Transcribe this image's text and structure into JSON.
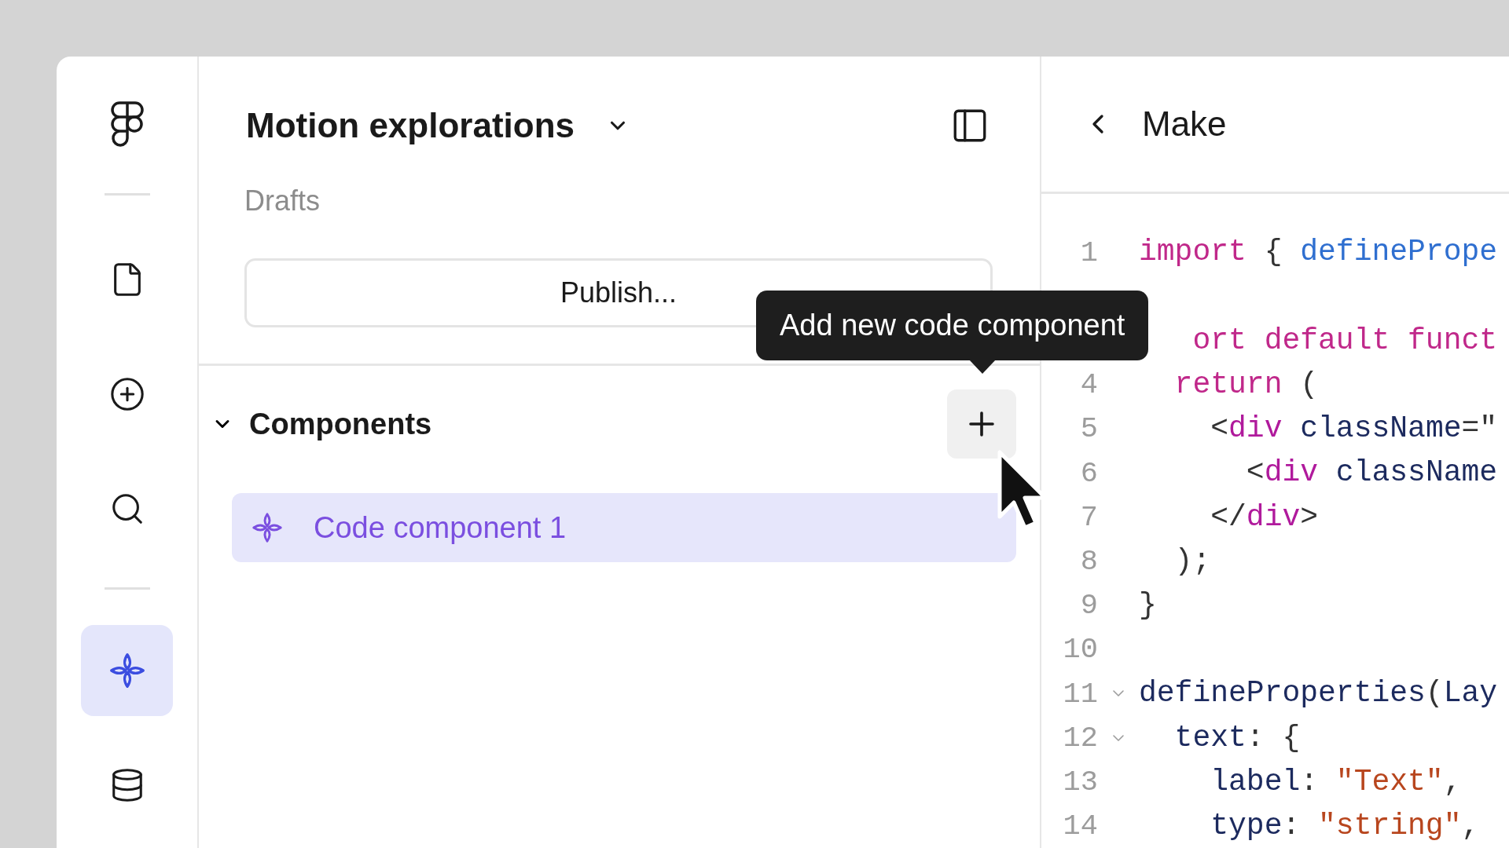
{
  "rail": {
    "groups": [
      [
        {
          "kind": "file",
          "selected": false
        },
        {
          "kind": "add",
          "selected": false
        },
        {
          "kind": "search",
          "selected": false
        }
      ],
      [
        {
          "kind": "components",
          "selected": true
        },
        {
          "kind": "data",
          "selected": false
        }
      ]
    ]
  },
  "panel": {
    "title": "Motion explorations",
    "subtitle": "Drafts",
    "publish_button": "Publish...",
    "section": {
      "title": "Components",
      "expanded": true,
      "items": [
        {
          "label": "Code component 1",
          "selected": true
        }
      ]
    },
    "tooltip": "Add new code component"
  },
  "editor": {
    "title": "Make",
    "lines": [
      {
        "number": "1",
        "tokens": [
          {
            "text": "import",
            "kind": "keyword"
          },
          {
            "text": " { ",
            "kind": "punct"
          },
          {
            "text": "definePrope",
            "kind": "ident"
          }
        ]
      },
      {
        "tokens": [
          {
            "text": "   ort default funct",
            "kind": "keyword"
          }
        ]
      },
      {
        "number": "4",
        "tokens": [
          {
            "text": "  return",
            "kind": "keyword"
          },
          {
            "text": " (",
            "kind": "punct"
          }
        ]
      },
      {
        "number": "5",
        "tokens": [
          {
            "text": "    <",
            "kind": "punct"
          },
          {
            "text": "div",
            "kind": "tag"
          },
          {
            "text": " className",
            "kind": "attr"
          },
          {
            "text": "=\"",
            "kind": "punct"
          }
        ]
      },
      {
        "number": "6",
        "tokens": [
          {
            "text": "      <",
            "kind": "punct"
          },
          {
            "text": "div",
            "kind": "tag"
          },
          {
            "text": " className",
            "kind": "attr"
          }
        ]
      },
      {
        "number": "7",
        "tokens": [
          {
            "text": "    </",
            "kind": "punct"
          },
          {
            "text": "div",
            "kind": "tag"
          },
          {
            "text": ">",
            "kind": "punct"
          }
        ]
      },
      {
        "number": "8",
        "tokens": [
          {
            "text": "  );",
            "kind": "punct"
          }
        ]
      },
      {
        "number": "9",
        "tokens": [
          {
            "text": "}",
            "kind": "punct"
          }
        ]
      },
      {
        "number": "10"
      },
      {
        "number": "11",
        "expanded": true,
        "tokens": [
          {
            "text": "defineProperties",
            "kind": "attr"
          },
          {
            "text": "(",
            "kind": "punct"
          },
          {
            "text": "Lay",
            "kind": "attr"
          }
        ]
      },
      {
        "number": "12",
        "expanded": true,
        "tokens": [
          {
            "text": "  text",
            "kind": "attr"
          },
          {
            "text": ": {",
            "kind": "punct"
          }
        ]
      },
      {
        "number": "13",
        "tokens": [
          {
            "text": "    label",
            "kind": "attr"
          },
          {
            "text": ": ",
            "kind": "punct"
          },
          {
            "text": "\"Text\"",
            "kind": "string"
          },
          {
            "text": ",",
            "kind": "punct"
          }
        ]
      },
      {
        "number": "14",
        "tokens": [
          {
            "text": "    type",
            "kind": "attr"
          },
          {
            "text": ": ",
            "kind": "punct"
          },
          {
            "text": "\"string\"",
            "kind": "string"
          },
          {
            "text": ",",
            "kind": "punct"
          }
        ]
      }
    ]
  }
}
